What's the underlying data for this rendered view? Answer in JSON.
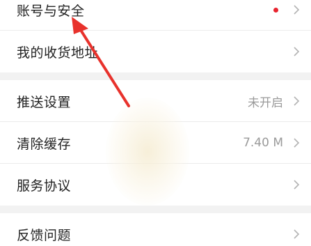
{
  "menu_groups": [
    {
      "items": [
        {
          "label": "账号与安全",
          "has_dot": true,
          "dot_color": "#e8242f"
        },
        {
          "label": "我的收货地址"
        }
      ]
    },
    {
      "items": [
        {
          "label": "推送设置",
          "value": "未开启"
        },
        {
          "label": "清除缓存",
          "value": "7.40 M"
        },
        {
          "label": "服务协议"
        }
      ]
    },
    {
      "items": [
        {
          "label": "反馈问题"
        }
      ]
    }
  ],
  "colors": {
    "annotation_arrow": "#e8322c",
    "notification_dot": "#e8242f",
    "background": "#f2f2f2"
  },
  "icons": {
    "row_chevron": "chevron-right-icon"
  }
}
